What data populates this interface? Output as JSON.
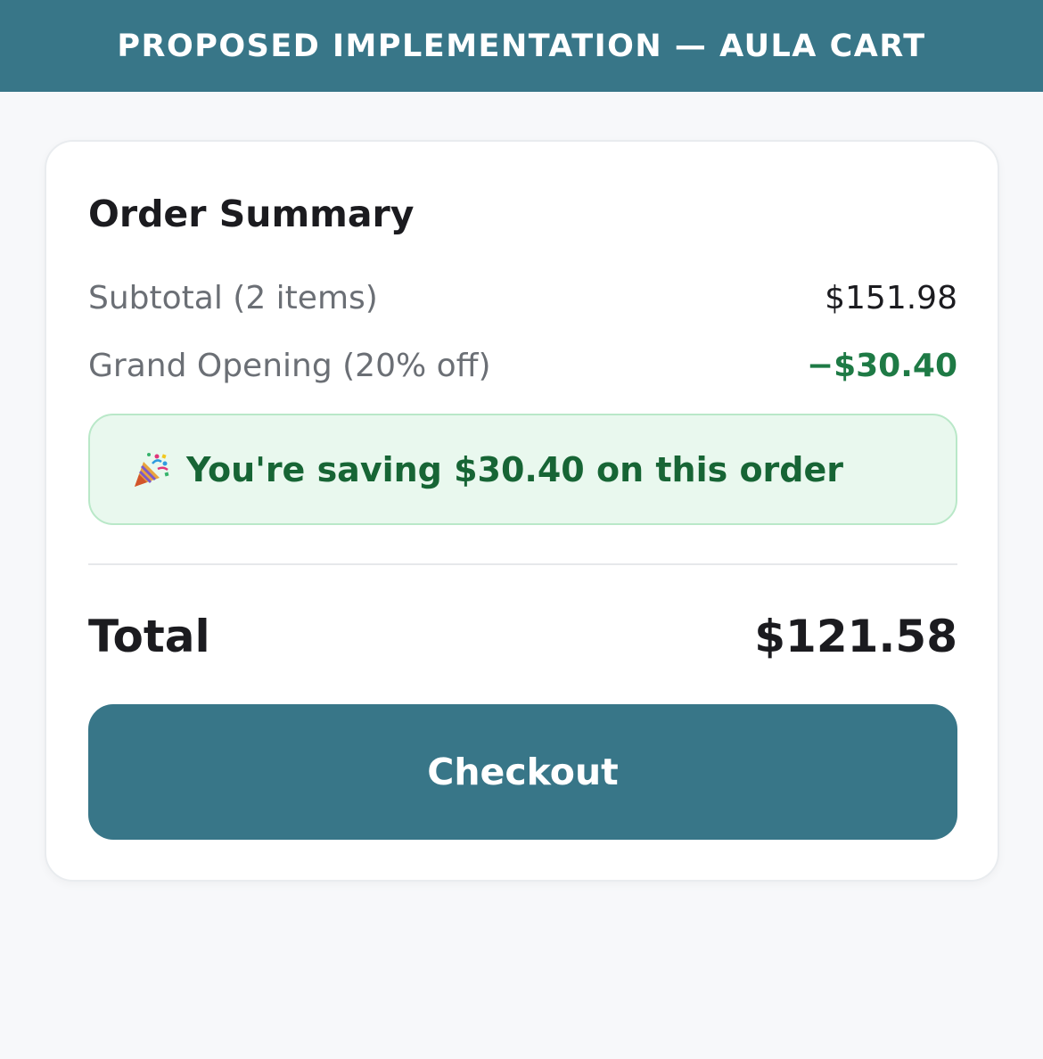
{
  "header": {
    "title": "PROPOSED IMPLEMENTATION — AULA CART"
  },
  "order_summary": {
    "title": "Order Summary",
    "subtotal_label": "Subtotal (2 items)",
    "subtotal_value": "$151.98",
    "discount_label": "Grand Opening (20% off)",
    "discount_value": "−$30.40",
    "savings_icon": "party-popper-icon",
    "savings_message": "You're saving $30.40 on this order",
    "total_label": "Total",
    "total_value": "$121.58",
    "checkout_label": "Checkout"
  },
  "colors": {
    "brand": "#387688",
    "discount_green": "#1e7a45",
    "savings_background": "#e9f8ee",
    "savings_border": "#b9e8c8",
    "page_background": "#f7f8fa"
  }
}
